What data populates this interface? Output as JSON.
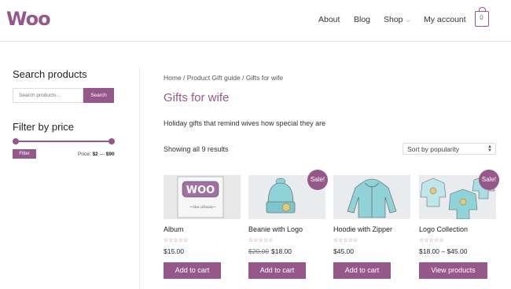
{
  "header": {
    "logo": "Woo",
    "nav": [
      {
        "label": "About"
      },
      {
        "label": "Blog"
      },
      {
        "label": "Shop"
      },
      {
        "label": "My account"
      }
    ],
    "cart_count": "0"
  },
  "sidebar": {
    "search_title": "Search products",
    "search_placeholder": "Search products…",
    "search_button": "Search",
    "filter_title": "Filter by price",
    "filter_button": "Filter",
    "price_prefix": "Price:",
    "price_min": "$2",
    "price_sep": "—",
    "price_max": "$90"
  },
  "main": {
    "breadcrumb": "Home / Product Gift guide / Gifts for wife",
    "title": "Gifts for wife",
    "description": "Holiday gifts that remind wives how special they are",
    "results": "Showing all 9 results",
    "sort_selected": "Sort by popularity"
  },
  "products": [
    {
      "name": "Album",
      "price": "$15.00",
      "old_price": "",
      "button": "Add to cart",
      "sale": "",
      "rating_stars": "☆☆☆☆☆"
    },
    {
      "name": "Beanie with Logo",
      "price": "$18.00",
      "old_price": "$20.00",
      "button": "Add to cart",
      "sale": "Sale!",
      "rating_stars": "☆☆☆☆☆"
    },
    {
      "name": "Hoodie with Zipper",
      "price": "$45.00",
      "old_price": "",
      "button": "Add to cart",
      "sale": "",
      "rating_stars": "☆☆☆☆☆"
    },
    {
      "name": "Logo Collection",
      "price": "$18.00 – $45.00",
      "old_price": "",
      "button": "View products",
      "sale": "Sale!",
      "rating_stars": "☆☆☆☆☆"
    }
  ],
  "colors": {
    "brand": "#96588a",
    "text": "#333333",
    "thumb_bg": "#e9ecef",
    "product_teal": "#8fd3d8"
  }
}
